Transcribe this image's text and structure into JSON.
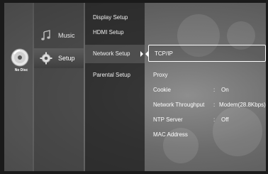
{
  "disc": {
    "icon": "disc-icon",
    "label": "No Disc"
  },
  "categories": [
    {
      "label": "Music",
      "icon": "music-note-icon"
    },
    {
      "label": "Setup",
      "icon": "gear-icon"
    }
  ],
  "setup_menu": {
    "items": [
      "Display Setup",
      "HDMI Setup",
      "Network Setup",
      "Parental Setup"
    ],
    "selected": "Network Setup"
  },
  "network_setup": {
    "selected": "TCP/IP",
    "options": [
      {
        "label": "TCP/IP",
        "value": ""
      },
      {
        "label": "Proxy",
        "value": ""
      },
      {
        "label": "Cookie",
        "value": "On"
      },
      {
        "label": "Network Throughput",
        "value": "Modem(28.8Kbps)"
      },
      {
        "label": "NTP Server",
        "value": "Off"
      },
      {
        "label": "MAC Address",
        "value": ""
      }
    ],
    "separator": ":"
  },
  "colors": {
    "highlight_border": "#ffffff",
    "text": "#ffffff"
  }
}
